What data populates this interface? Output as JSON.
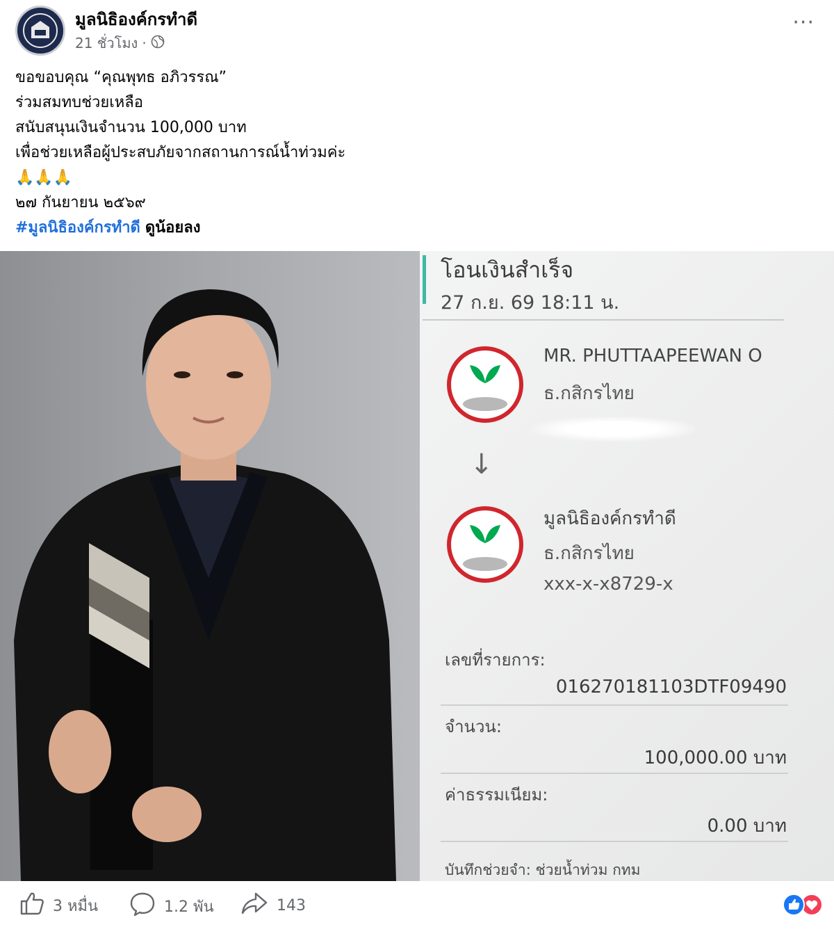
{
  "post": {
    "page_name": "มูลนิธิองค์กรทำดี",
    "time": "21 ชั่วโมง",
    "separator": "·",
    "privacy_icon": "globe-icon",
    "more_label": "···",
    "lines": [
      "ขอขอบคุณ “คุณพุทธ อภิวรรณ”",
      "ร่วมสมทบช่วยเหลือ",
      "สนับสนุนเงินจำนวน 100,000 บาท",
      "เพื่อช่วยเหลือผู้ประสบภัยจากสถานการณ์น้ำท่วมค่ะ",
      "🙏🙏🙏",
      "๒๗ กันยายน ๒๕๖๙"
    ],
    "hashtag": "#มูลนิธิองค์กรทำดี",
    "hashtag_suffix": "ดูน้อยลง"
  },
  "slip": {
    "title": "โอนเงินสำเร็จ",
    "datetime": "27 ก.ย. 69  18:11 น.",
    "sender": {
      "name": "MR. PHUTTAAPEEWAN O",
      "bank": "ธ.กสิกรไทย"
    },
    "receiver": {
      "name": "มูลนิธิองค์กรทำดี",
      "bank": "ธ.กสิกรไทย",
      "account": "xxx-x-x8729-x"
    },
    "arrow": "↓",
    "ref_label": "เลขที่รายการ:",
    "ref_value": "016270181103DTF09490",
    "amount_label": "จำนวน:",
    "amount_value": "100,000.00 บาท",
    "fee_label": "ค่าธรรมเนียม:",
    "fee_value": "0.00 บาท",
    "memo": "บันทึกช่วยจำ: ช่วยน้ำท่วม กทม",
    "brand_color": "#00a950",
    "ring_color": "#d0262d"
  },
  "footer": {
    "like_count": "3 หมื่น",
    "comment_count": "1.2 พัน",
    "share_count": "143",
    "like_icon": "thumbs-up-icon",
    "comment_icon": "comment-bubble-icon",
    "share_icon": "share-arrow-icon"
  },
  "colors": {
    "link": "#216fdb",
    "meta": "#65676b",
    "like_blue": "#1877f2",
    "love_red": "#f33e58"
  }
}
